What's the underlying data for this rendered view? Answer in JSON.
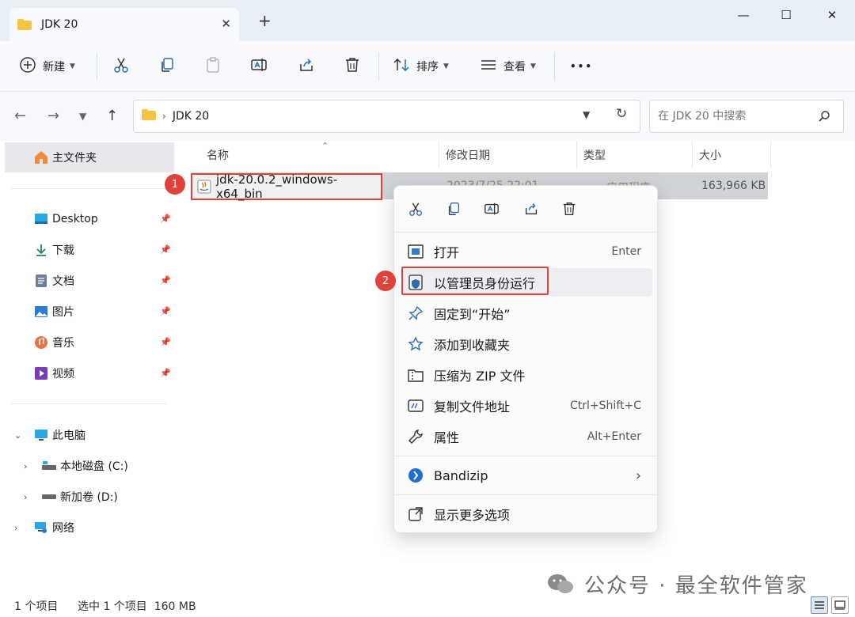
{
  "window": {
    "tab_title": "JDK 20",
    "tab_close": "✕",
    "tab_add": "+",
    "controls": {
      "minimize": "—",
      "maximize": "☐",
      "close": "✕"
    }
  },
  "toolbar": {
    "new_label": "新建",
    "sort_label": "排序",
    "view_label": "查看",
    "more_label": "•••"
  },
  "address": {
    "crumb": "JDK 20",
    "search_placeholder": "在 JDK 20 中搜索"
  },
  "sidebar": {
    "home": "主文件夹",
    "quick": [
      {
        "label": "Desktop",
        "icon": "desktop-icon"
      },
      {
        "label": "下载",
        "icon": "download-icon"
      },
      {
        "label": "文档",
        "icon": "document-icon"
      },
      {
        "label": "图片",
        "icon": "pictures-icon"
      },
      {
        "label": "音乐",
        "icon": "music-icon"
      },
      {
        "label": "视频",
        "icon": "video-icon"
      }
    ],
    "this_pc": "此电脑",
    "drives": [
      {
        "label": "本地磁盘 (C:)"
      },
      {
        "label": "新加卷 (D:)"
      }
    ],
    "network": "网络"
  },
  "columns": {
    "name": "名称",
    "modified": "修改日期",
    "type": "类型",
    "size": "大小"
  },
  "file": {
    "name": "jdk-20.0.2_windows-x64_bin",
    "modified": "2023/7/25 22:01",
    "type": "应用程序",
    "size": "163,966 KB"
  },
  "annotations": {
    "step1": "1",
    "step2": "2"
  },
  "context_menu": {
    "items": [
      {
        "label": "打开",
        "key": "Enter"
      },
      {
        "label": "以管理员身份运行",
        "key": ""
      },
      {
        "label": "固定到“开始”",
        "key": ""
      },
      {
        "label": "添加到收藏夹",
        "key": ""
      },
      {
        "label": "压缩为 ZIP 文件",
        "key": ""
      },
      {
        "label": "复制文件地址",
        "key": "Ctrl+Shift+C"
      },
      {
        "label": "属性",
        "key": "Alt+Enter"
      },
      {
        "label": "Bandizip",
        "key": "›"
      },
      {
        "label": "显示更多选项",
        "key": ""
      }
    ]
  },
  "status": {
    "count": "1 个项目",
    "selected": "选中 1 个项目  160 MB"
  },
  "watermark": "公众号 · 最全软件管家",
  "colors": {
    "accent": "#0067c0",
    "highlight_red": "#e0413a",
    "folder_yellow": "#f4c542"
  }
}
